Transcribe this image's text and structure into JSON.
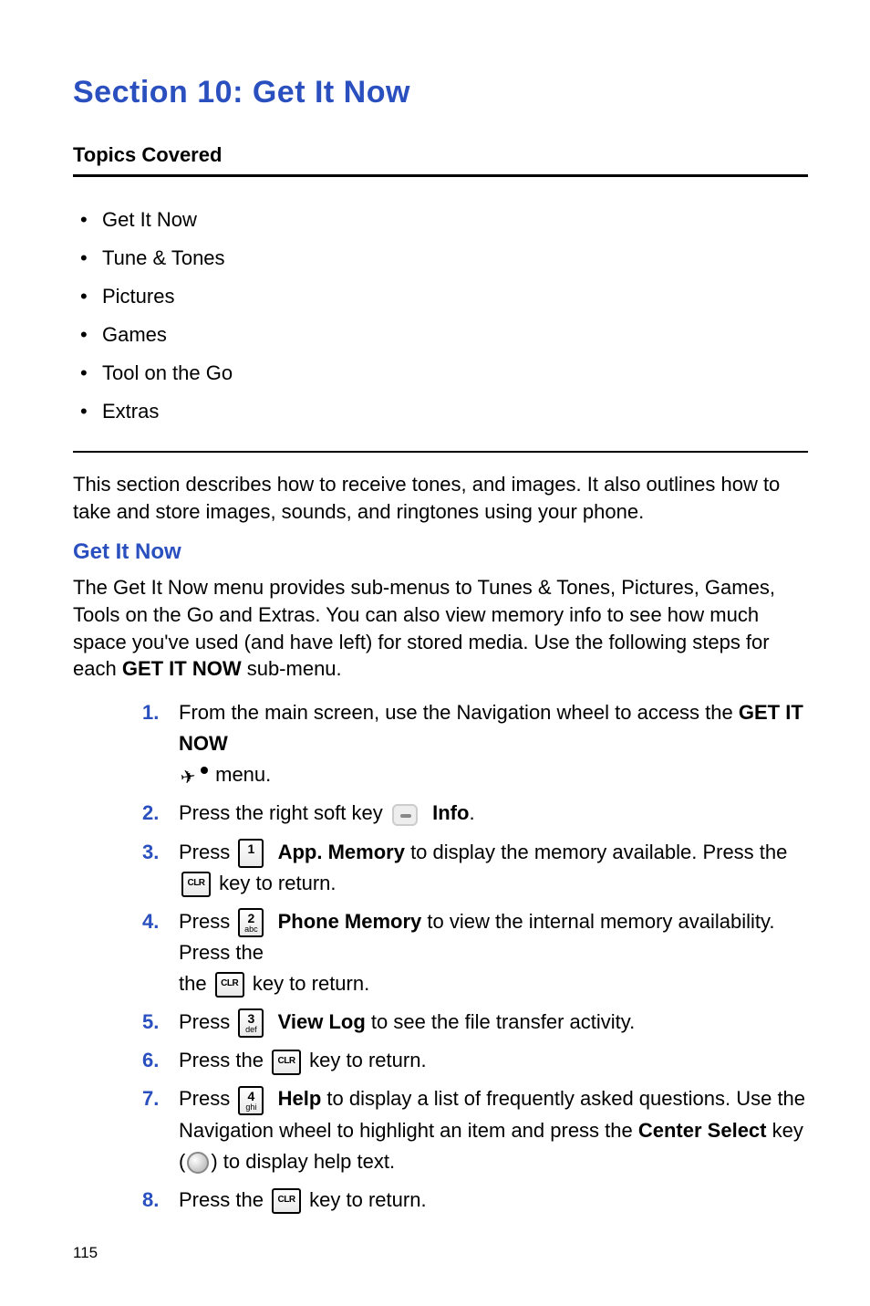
{
  "section_title": "Section 10: Get It Now",
  "topics_label": "Topics Covered",
  "topics": [
    "Get It Now",
    "Tune & Tones",
    "Pictures",
    "Games",
    "Tool on the Go",
    "Extras"
  ],
  "intro": "This section describes how to receive tones, and images. It also outlines how to take and store images, sounds, and ringtones using your phone.",
  "subhead": "Get It Now",
  "subhead_body_pre": "The Get It Now menu provides sub-menus to Tunes & Tones, Pictures, Games, Tools on the Go and Extras. You can also view memory info to see how much space you've used (and have left) for stored media. Use the following steps for each ",
  "subhead_body_bold": "GET IT NOW",
  "subhead_body_post": " sub-menu.",
  "steps": {
    "s1_pre": "From the main screen, use the Navigation wheel to access the ",
    "s1_bold": "GET IT NOW",
    "s1_post": " menu.",
    "s2_pre": "Press the right soft key ",
    "s2_bold": "Info",
    "s2_post": ".",
    "s3_pre": "Press ",
    "s3_bold": "App. Memory",
    "s3_mid": " to display the memory available. Press the ",
    "s3_post": " key to return.",
    "s4_pre": "Press ",
    "s4_bold": "Phone Memory",
    "s4_mid": " to view the internal memory availability. Press the ",
    "s4_post": " key to return.",
    "s5_pre": "Press ",
    "s5_bold": "View Log",
    "s5_post": " to see the file transfer activity.",
    "s6_pre": "Press the ",
    "s6_post": " key to return.",
    "s7_pre": "Press ",
    "s7_bold": "Help",
    "s7_mid": " to display a list of frequently asked questions. Use the Navigation wheel to highlight an item and press the ",
    "s7_bold2": "Center Select",
    "s7_mid2": " key (",
    "s7_post": ") to display help text.",
    "s8_pre": "Press the ",
    "s8_post": " key to return."
  },
  "keys": {
    "k1_big": "1",
    "k1_small": "",
    "k2_big": "2",
    "k2_small": "abc",
    "k3_big": "3",
    "k3_small": "def",
    "k4_big": "4",
    "k4_small": "ghi",
    "clr": "CLR"
  },
  "page_number": "115"
}
